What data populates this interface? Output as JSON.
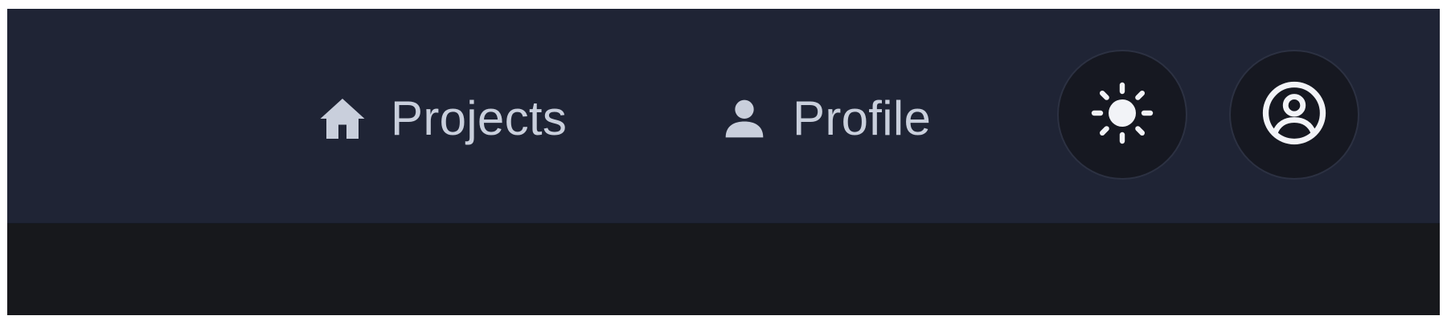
{
  "nav": {
    "links": [
      {
        "label": "Projects",
        "icon": "home-icon"
      },
      {
        "label": "Profile",
        "icon": "user-icon"
      }
    ],
    "actions": [
      {
        "icon": "sun-icon",
        "purpose": "theme-toggle"
      },
      {
        "icon": "user-circle-icon",
        "purpose": "account"
      }
    ]
  },
  "colors": {
    "navbar_background": "#1f2435",
    "page_background": "#17181c",
    "text": "#c9cfdc",
    "button_background": "#161821",
    "button_border": "#2c3142",
    "icon_light": "#f2f3f7"
  }
}
